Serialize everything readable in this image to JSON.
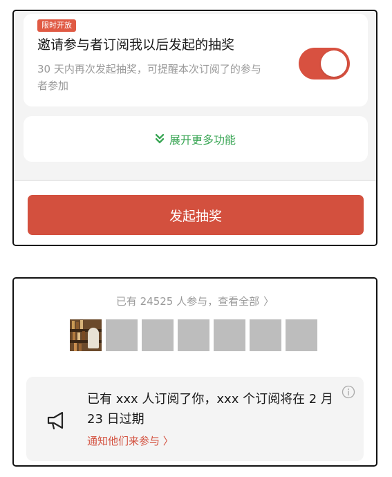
{
  "lottery_settings": {
    "badge": "限时开放",
    "invite_title": "邀请参与者订阅我以后发起的抽奖",
    "invite_desc": "30 天内再次发起抽奖，可提醒本次订阅了的参与者参加",
    "toggle_on": true,
    "expand_more": "展开更多功能",
    "start_button": "发起抽奖"
  },
  "participants": {
    "summary": "已有 24525 人参与，查看全部",
    "chevron": "〉",
    "avatar_count": 7
  },
  "notice": {
    "message": "已有 xxx 人订阅了你，xxx 个订阅将在 2 月 23 日过期",
    "link": "通知他们来参与 〉",
    "icons": [
      "megaphone-icon",
      "info-icon"
    ]
  },
  "colors": {
    "accent_red": "#d3503e",
    "green": "#3aa655",
    "muted_text": "#999999"
  }
}
